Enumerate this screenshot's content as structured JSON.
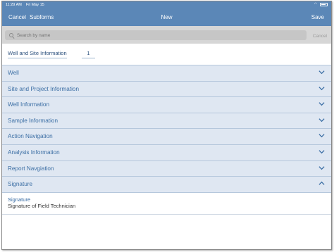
{
  "status_bar": {
    "time": "11:29 AM",
    "date": "Fri May 15"
  },
  "nav": {
    "cancel_label": "Cancel",
    "subforms_label": "Subforms",
    "title": "New",
    "save_label": "Save"
  },
  "search": {
    "placeholder": "Search by name",
    "cancel_label": "Cancel"
  },
  "form": {
    "name": "Well and Site Information",
    "number": "1"
  },
  "sections": [
    {
      "label": "Well",
      "state": "collapsed"
    },
    {
      "label": "Site and Project Information",
      "state": "collapsed"
    },
    {
      "label": "Well Information",
      "state": "collapsed"
    },
    {
      "label": "Sample Information",
      "state": "collapsed"
    },
    {
      "label": "Action Navigation",
      "state": "collapsed"
    },
    {
      "label": "Analysis Information",
      "state": "collapsed"
    },
    {
      "label": "Report Navgiation",
      "state": "collapsed"
    },
    {
      "label": "Signature",
      "state": "expanded"
    }
  ],
  "signature_field": {
    "title": "Signature",
    "description": "Signature of Field Technician"
  },
  "colors": {
    "nav_blue": "#5b87b7",
    "section_bg": "#dfe7f2",
    "section_text": "#3b6ea4"
  },
  "icons": {
    "collapsed": "chevron-down-icon",
    "expanded": "chevron-up-icon"
  }
}
